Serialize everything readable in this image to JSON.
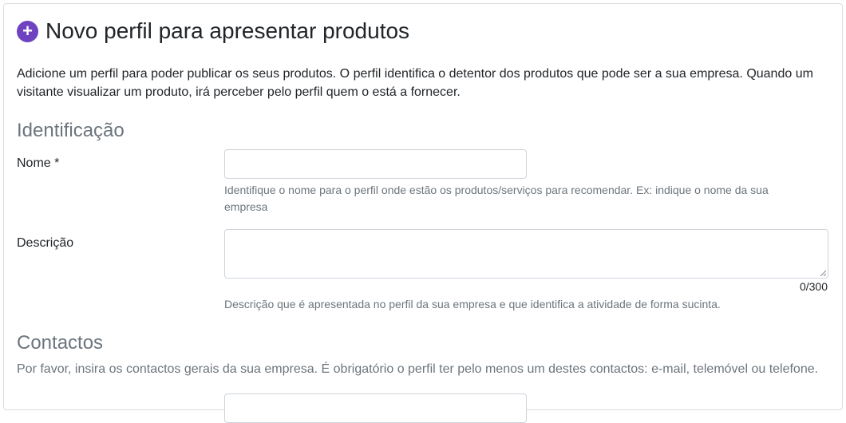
{
  "header": {
    "icon": "plus-circle-icon",
    "accent_color": "#6f42c1",
    "title": "Novo perfil para apresentar produtos"
  },
  "intro": "Adicione um perfil para poder publicar os seus produtos. O perfil identifica o detentor dos produtos que pode ser a sua empresa. Quando um visitante visualizar um produto, irá perceber pelo perfil quem o está a fornecer.",
  "identificacao": {
    "title": "Identificação",
    "nome": {
      "label": "Nome *",
      "value": "",
      "help": "Identifique o nome para o perfil onde estão os produtos/serviços para recomendar. Ex: indique o nome da sua empresa"
    },
    "descricao": {
      "label": "Descrição",
      "value": "",
      "counter": "0/300",
      "help": "Descrição que é apresentada no perfil da sua empresa e que identifica a atividade de forma sucinta."
    }
  },
  "contactos": {
    "title": "Contactos",
    "text": "Por favor, insira os contactos gerais da sua empresa. É obrigatório o perfil ter pelo menos um destes contactos: e-mail, telemóvel ou telefone."
  }
}
